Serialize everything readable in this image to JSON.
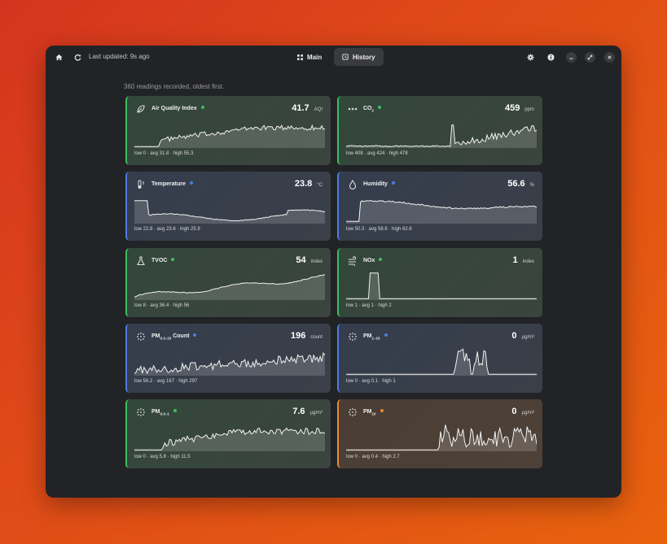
{
  "header": {
    "last_updated": "Last updated: 9s ago",
    "tabs": [
      {
        "label": "Main",
        "active": false
      },
      {
        "label": "History",
        "active": true
      }
    ]
  },
  "subtitle": "360 readings recorded, oldest first.",
  "colors": {
    "green": "#3fbf5d",
    "blue": "#4a7de0",
    "orange": "#e88c30"
  },
  "cards": [
    {
      "name": "Air Quality Index",
      "sub": "",
      "icon": "leaf-icon",
      "status": "green",
      "value": "41.7",
      "unit": "AQI",
      "stats": "low 0 · avg 31.8 · high 55.3"
    },
    {
      "name": "CO",
      "sub": "2",
      "icon": "dots-icon",
      "status": "green",
      "value": "459",
      "unit": "ppm",
      "stats": "low 408 · avg 424 · high 478"
    },
    {
      "name": "Temperature",
      "sub": "",
      "icon": "thermometer-icon",
      "status": "blue",
      "value": "23.8",
      "unit": "°C",
      "stats": "low 22.8 · avg 23.6 · high 25.9"
    },
    {
      "name": "Humidity",
      "sub": "",
      "icon": "droplet-icon",
      "status": "blue",
      "value": "56.6",
      "unit": "%",
      "stats": "low 50.3 · avg 58.8 · high 62.6"
    },
    {
      "name": "TVOC",
      "sub": "",
      "icon": "flask-icon",
      "status": "green",
      "value": "54",
      "unit": "index",
      "stats": "low 8 · avg 36.4 · high 56"
    },
    {
      "name": "NOx",
      "sub": "",
      "icon": "wind-icon",
      "status": "green",
      "value": "1",
      "unit": "index",
      "stats": "low 1 · avg 1 · high 2"
    },
    {
      "name": "PM",
      "sub": "0.3–10",
      "name_suffix": " Count",
      "icon": "particles-icon",
      "status": "blue",
      "value": "196",
      "unit": "count",
      "stats": "low 56.2 · avg 167 · high 297"
    },
    {
      "name": "PM",
      "sub": "1–10",
      "icon": "particles-icon",
      "status": "blue",
      "value": "0",
      "unit": "µg/m³",
      "stats": "low 0 · avg 0.1 · high 1"
    },
    {
      "name": "PM",
      "sub": "0.3–1",
      "icon": "particles-icon",
      "status": "green",
      "value": "7.6",
      "unit": "µg/m³",
      "stats": "low 0 · avg 5.8 · high 11.5"
    },
    {
      "name": "PM",
      "sub": "10",
      "icon": "particles-icon",
      "status": "orange",
      "value": "0",
      "unit": "µg/m³",
      "stats": "low 0 · avg 0.4 · high 2.7"
    }
  ]
}
